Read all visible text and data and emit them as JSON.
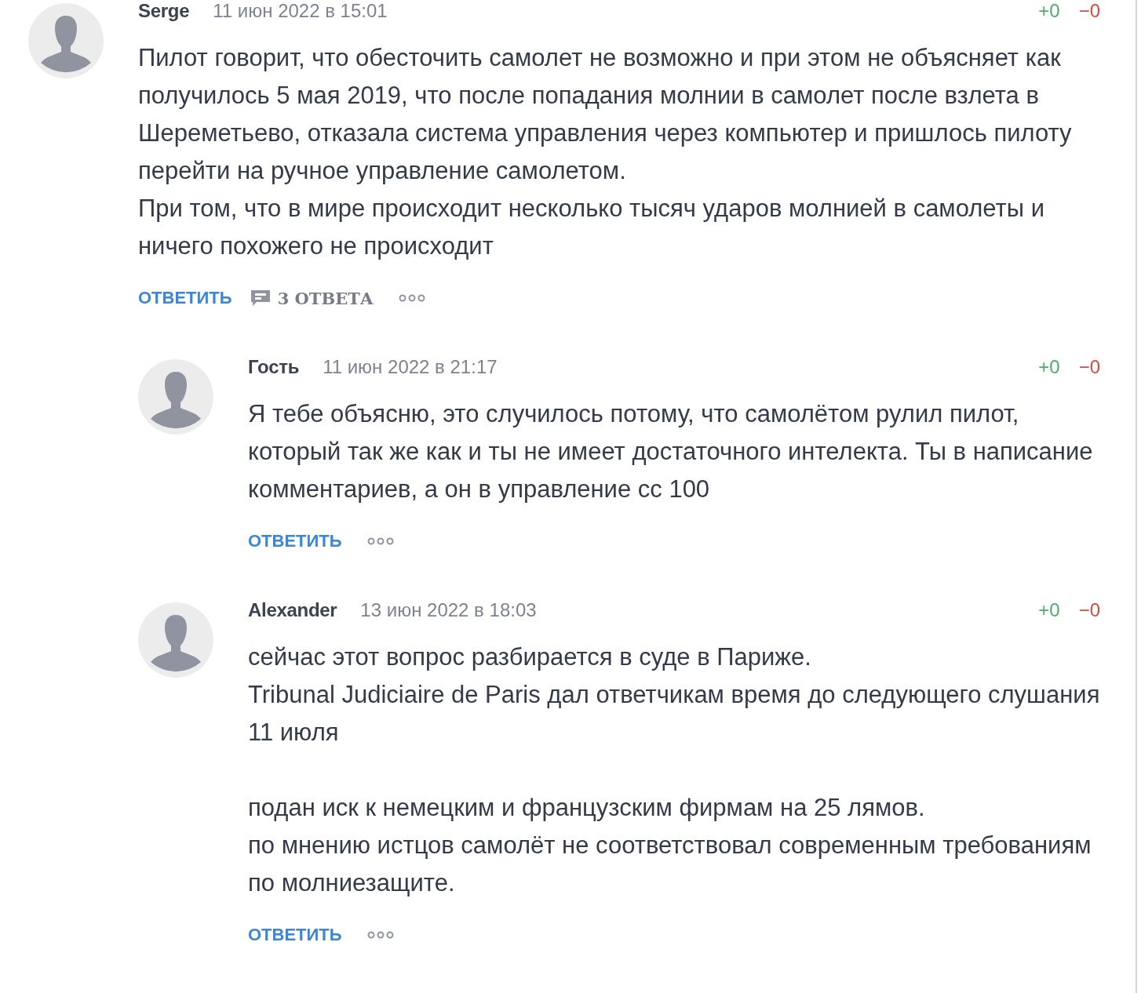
{
  "comments": [
    {
      "author": "Serge",
      "date": "11 июн 2022 в 15:01",
      "votes_up": "+0",
      "votes_down": "−0",
      "paragraphs": [
        "Пилот говорит, что обесточить самолет не возможно и при этом не объясняет как получилось 5 мая 2019, что после попадания молнии в самолет после взлета в Шереметьево, отказала система управления через компьютер и пришлось пилоту перейти на ручное управление самолетом.\nПри том, что в мире происходит несколько тысяч ударов молнией в самолеты и ничего похожего не происходит"
      ],
      "reply_label": "ОТВЕТИТЬ",
      "replies_count": "3 ОТВЕТА",
      "children": [
        {
          "author": "Гость",
          "date": "11 июн 2022 в 21:17",
          "votes_up": "+0",
          "votes_down": "−0",
          "paragraphs": [
            "Я тебе объясню, это случилось потому, что самолётом рулил пилот, который так же как и ты не имеет достаточного интелекта. Ты в написание комментариев, а он в управление сс 100"
          ],
          "reply_label": "ОТВЕТИТЬ"
        },
        {
          "author": "Alexander",
          "date": "13 июн 2022 в 18:03",
          "votes_up": "+0",
          "votes_down": "−0",
          "paragraphs": [
            "сейчас этот вопрос разбирается в суде в Париже.\nTribunal Judiciaire de Paris дал ответчикам время до следующего слушания 11 июля",
            "подан иск к немецким и французским фирмам на 25 лямов.\nпо мнению истцов самолёт не соответствовал современным требованиям по молниезащите."
          ],
          "reply_label": "ОТВЕТИТЬ"
        }
      ]
    }
  ]
}
